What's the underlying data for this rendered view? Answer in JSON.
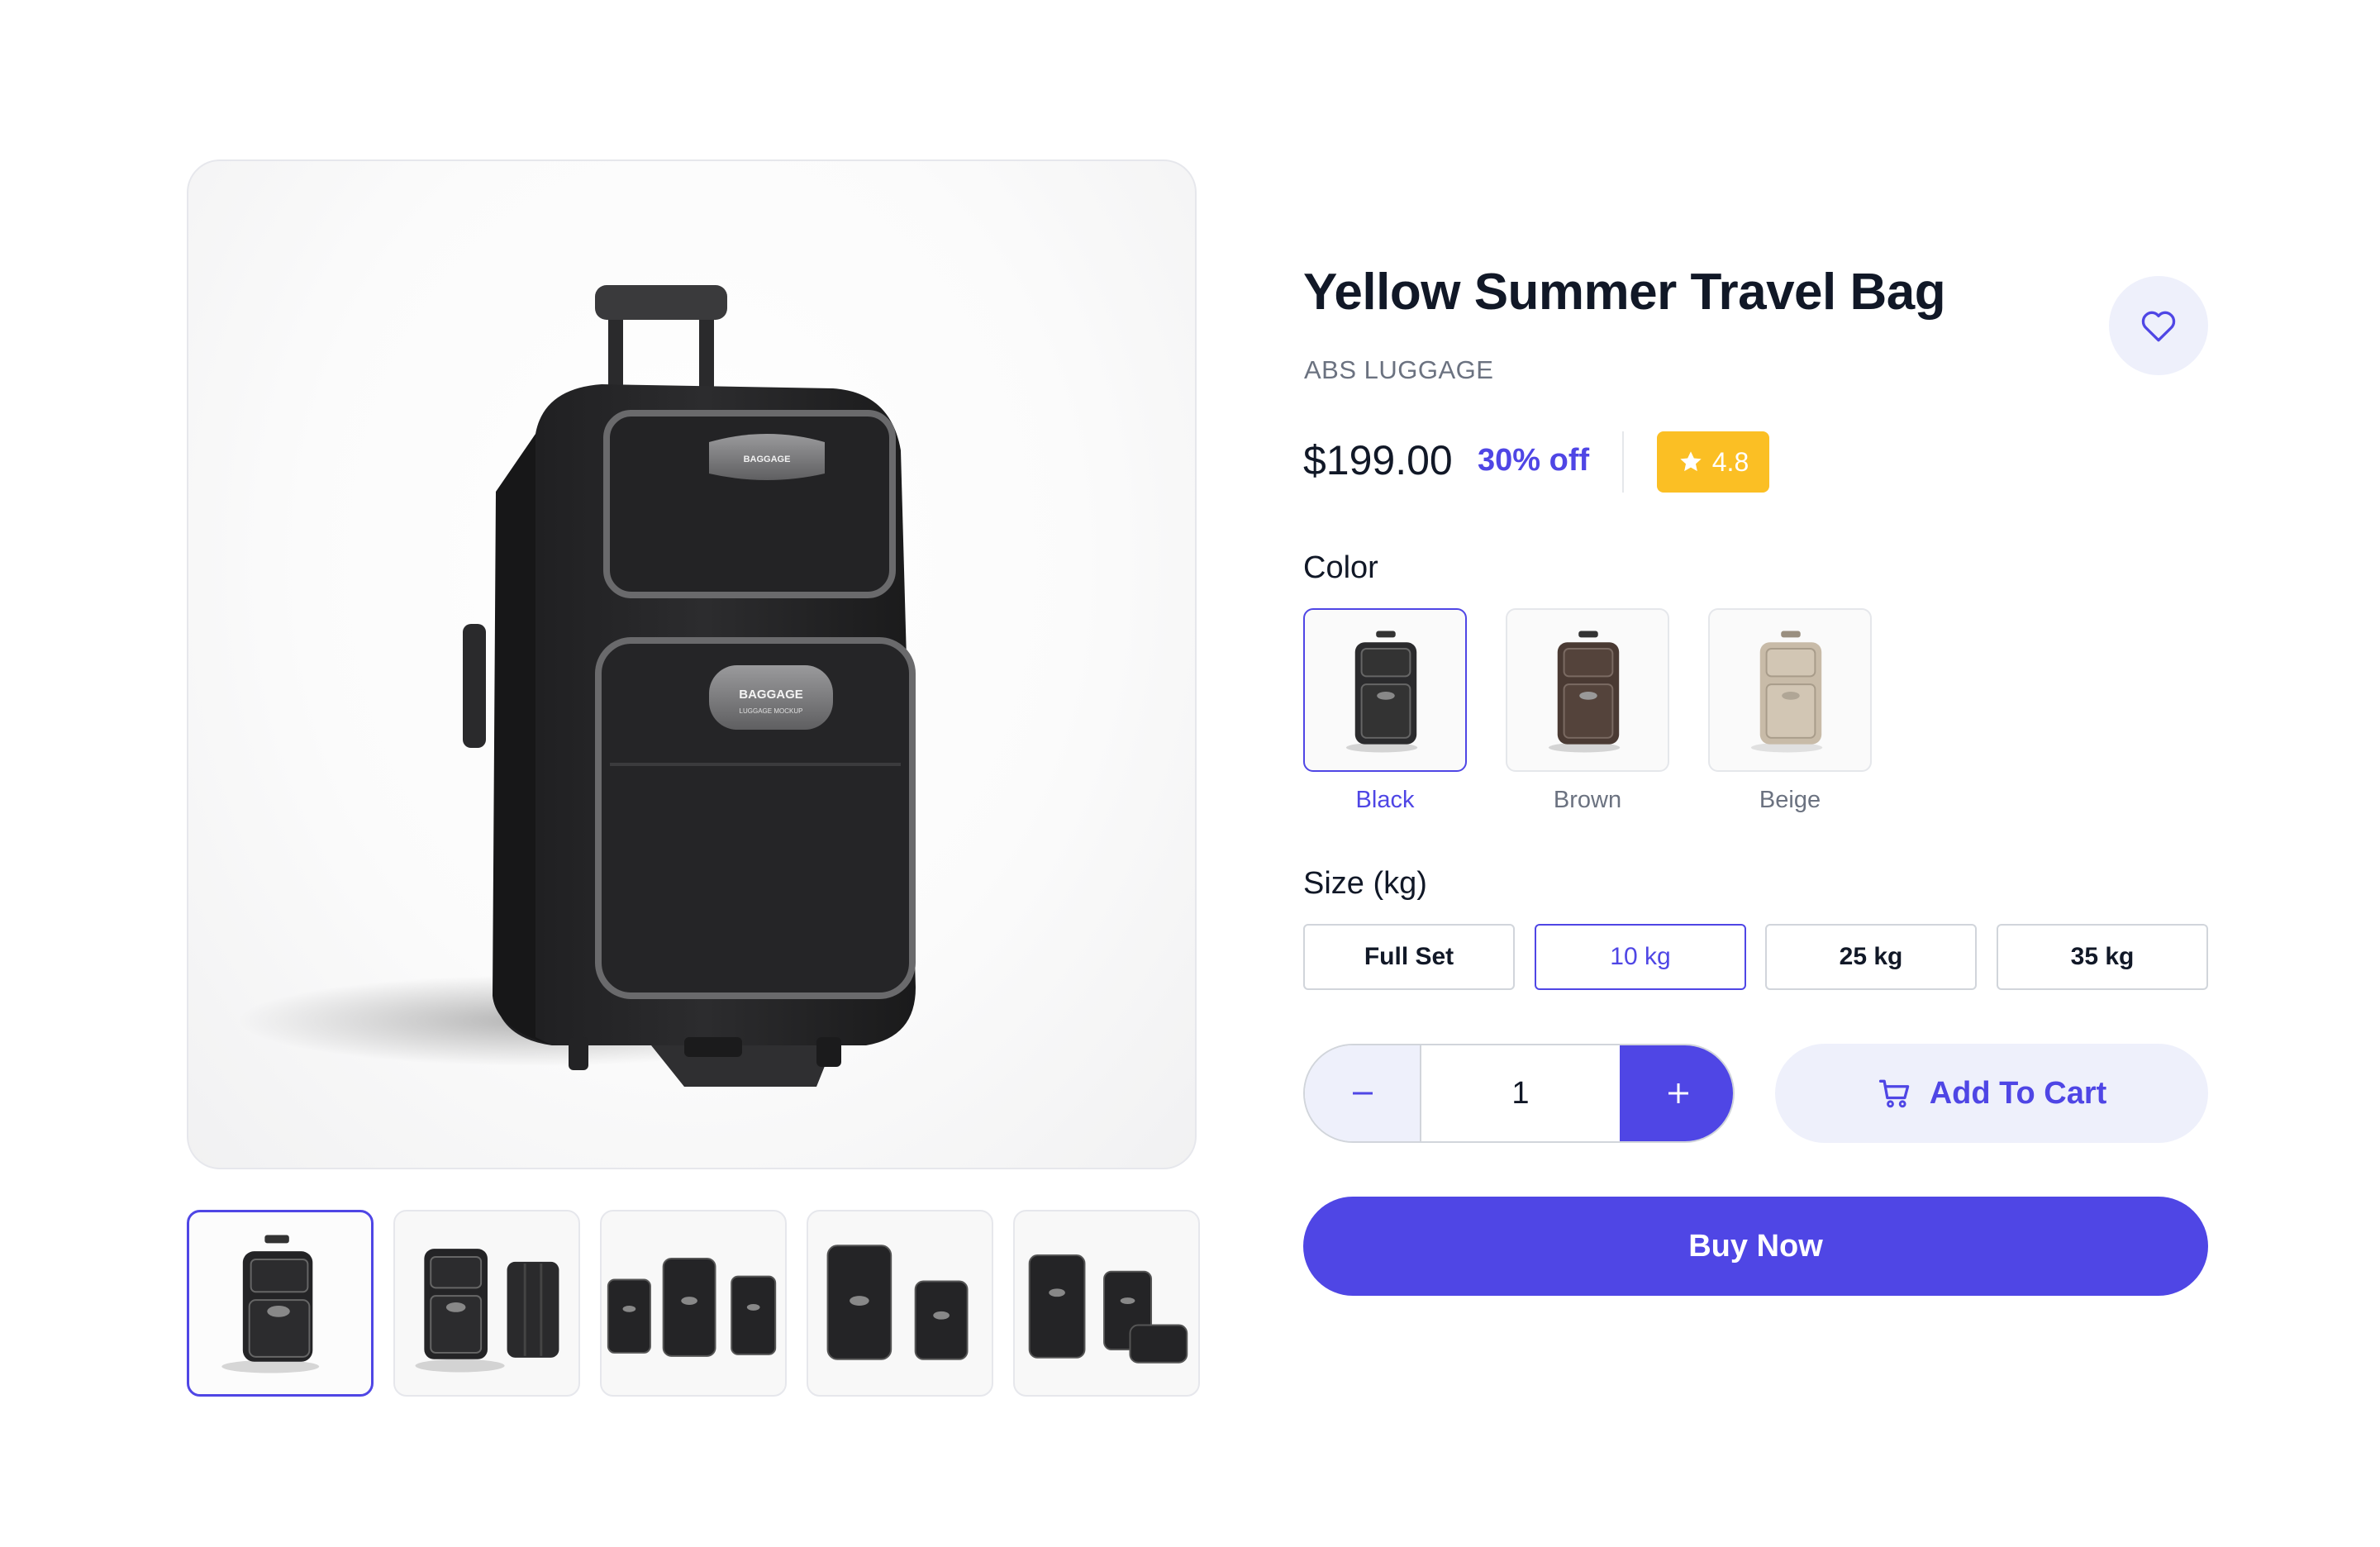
{
  "product": {
    "title": "Yellow Summer Travel Bag",
    "brand": "ABS LUGGAGE",
    "price": "$199.00",
    "discount": "30% off",
    "rating": "4.8",
    "rating_fraction": 0.96
  },
  "gallery": {
    "main_image": "black-suitcase-photo",
    "badge_text": "BAGGAGE",
    "badge_subtext": "LUGGAGE MOCKUP",
    "thumbnails": [
      {
        "name": "single-suitcase",
        "active": true
      },
      {
        "name": "front-and-side-view"
      },
      {
        "name": "three-suitcases"
      },
      {
        "name": "two-suitcases"
      },
      {
        "name": "luggage-set"
      }
    ]
  },
  "color": {
    "label": "Color",
    "options": [
      {
        "label": "Black",
        "hex": "#2b2b2d",
        "active": true
      },
      {
        "label": "Brown",
        "hex": "#4a3a33"
      },
      {
        "label": "Beige",
        "hex": "#c8bba8"
      }
    ]
  },
  "size": {
    "label": "Size (kg)",
    "options": [
      {
        "label": "Full Set"
      },
      {
        "label": "10 kg",
        "active": true
      },
      {
        "label": "25 kg"
      },
      {
        "label": "35 kg"
      }
    ]
  },
  "quantity": {
    "value": "1",
    "minus_icon": "minus-icon",
    "plus_icon": "plus-icon"
  },
  "actions": {
    "add_to_cart": "Add To Cart",
    "buy_now": "Buy Now",
    "cart_icon": "cart-icon",
    "favorite_icon": "heart-icon"
  },
  "colors": {
    "accent": "#4f46e5",
    "accent_light": "#eef0fb",
    "rating_bg": "#fbbf24"
  }
}
